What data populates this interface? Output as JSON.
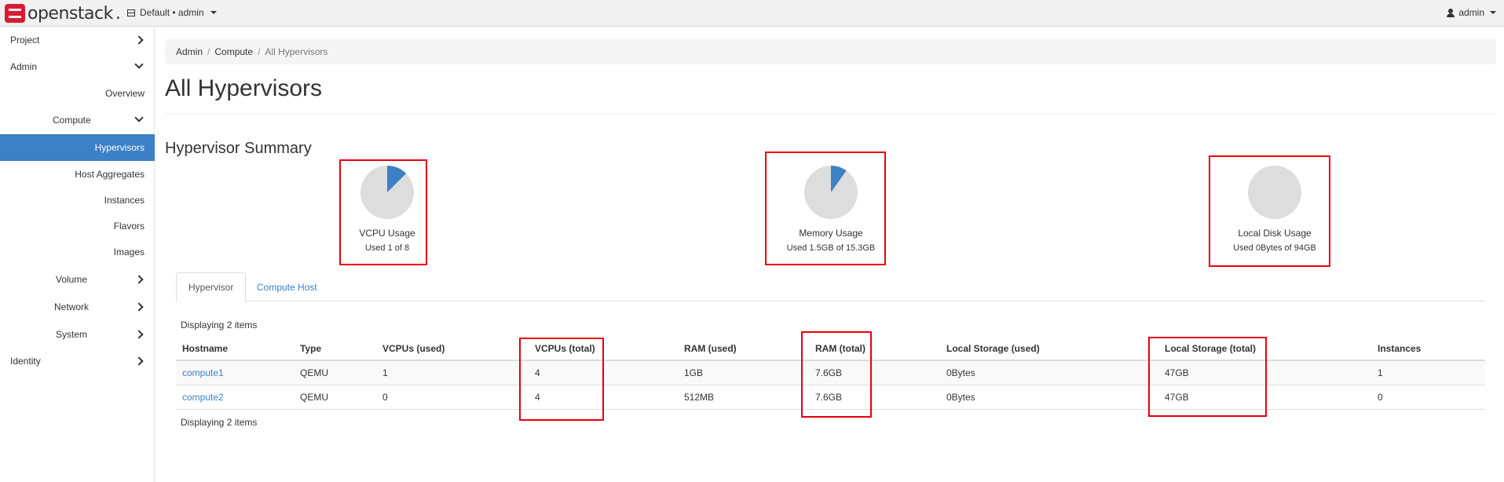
{
  "brand": {
    "name": "openstack",
    "dot": "."
  },
  "navbar": {
    "project_switch": "Default • admin",
    "user": "admin"
  },
  "sidebar": {
    "project": "Project",
    "admin": "Admin",
    "overview": "Overview",
    "compute": "Compute",
    "hypervisors": "Hypervisors",
    "host_aggregates": "Host Aggregates",
    "instances": "Instances",
    "flavors": "Flavors",
    "images": "Images",
    "volume": "Volume",
    "network": "Network",
    "system": "System",
    "identity": "Identity"
  },
  "breadcrumb": {
    "admin": "Admin",
    "compute": "Compute",
    "current": "All Hypervisors",
    "sep": "/"
  },
  "page_title": "All Hypervisors",
  "summary": {
    "title": "Hypervisor Summary",
    "vcpu": {
      "title": "VCPU Usage",
      "subtitle": "Used 1 of 8",
      "fraction": 0.125
    },
    "memory": {
      "title": "Memory Usage",
      "subtitle": "Used 1.5GB of 15.3GB",
      "fraction": 0.098
    },
    "disk": {
      "title": "Local Disk Usage",
      "subtitle": "Used 0Bytes of 94GB",
      "fraction": 0
    }
  },
  "colors": {
    "pie_used": "#3c80c6",
    "pie_free": "#dddddd",
    "highlight": "#e8000b",
    "active": "#3c80c6"
  },
  "tabs": {
    "hypervisor": "Hypervisor",
    "compute_host": "Compute Host"
  },
  "table": {
    "count_top": "Displaying 2 items",
    "count_bottom": "Displaying 2 items",
    "headers": [
      "Hostname",
      "Type",
      "VCPUs (used)",
      "VCPUs (total)",
      "RAM (used)",
      "RAM (total)",
      "Local Storage (used)",
      "Local Storage (total)",
      "Instances"
    ],
    "rows": [
      [
        "compute1",
        "QEMU",
        "1",
        "4",
        "1GB",
        "7.6GB",
        "0Bytes",
        "47GB",
        "1"
      ],
      [
        "compute2",
        "QEMU",
        "0",
        "4",
        "512MB",
        "7.6GB",
        "0Bytes",
        "47GB",
        "0"
      ]
    ]
  }
}
